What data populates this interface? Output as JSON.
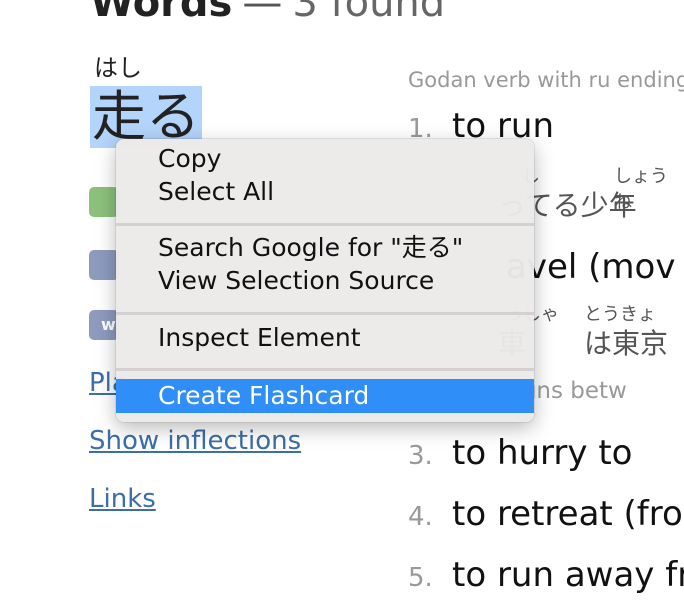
{
  "header": {
    "title": "Words",
    "separator": "—",
    "found": "3 found"
  },
  "entry": {
    "furigana": "はし",
    "word": "走る",
    "tag_text": "w"
  },
  "sidebar_links": [
    "Play audio",
    "Show inflections",
    "Links"
  ],
  "sidebar_links_visible": [
    "Pla",
    "Show inflections",
    "Links"
  ],
  "definitions": {
    "part_of_speech": "Godan verb with ru ending",
    "meanings": [
      {
        "num": "1.",
        "text": "to run"
      },
      {
        "num": "2.",
        "text": "avel (mov"
      },
      {
        "num": "3.",
        "text": "to hurry to"
      },
      {
        "num": "4.",
        "text": "to retreat (fron"
      },
      {
        "num": "5.",
        "text": "to run away fr"
      }
    ],
    "example1": {
      "furigana_a": "し",
      "furigana_b": "しょうね",
      "text": "ってる少年"
    },
    "example2": {
      "furigana_a": "っしゃ",
      "furigana_b": "とうきょ",
      "text_a": "車",
      "text_b": "は東京"
    },
    "example2_translation": "ain runs betw"
  },
  "context_menu": {
    "items": [
      {
        "label": "Copy"
      },
      {
        "label": "Select All"
      },
      {
        "label": "Search Google for \"走る\""
      },
      {
        "label": "View Selection Source"
      },
      {
        "label": "Inspect Element"
      },
      {
        "label": "Create Flashcard",
        "highlighted": true
      }
    ]
  },
  "colors": {
    "highlight": "#2f8ef7",
    "link": "#3c6ea8",
    "selection": "#b3d4fb",
    "tag_green": "#8cc17c",
    "tag_blue": "#8d9bbf"
  }
}
